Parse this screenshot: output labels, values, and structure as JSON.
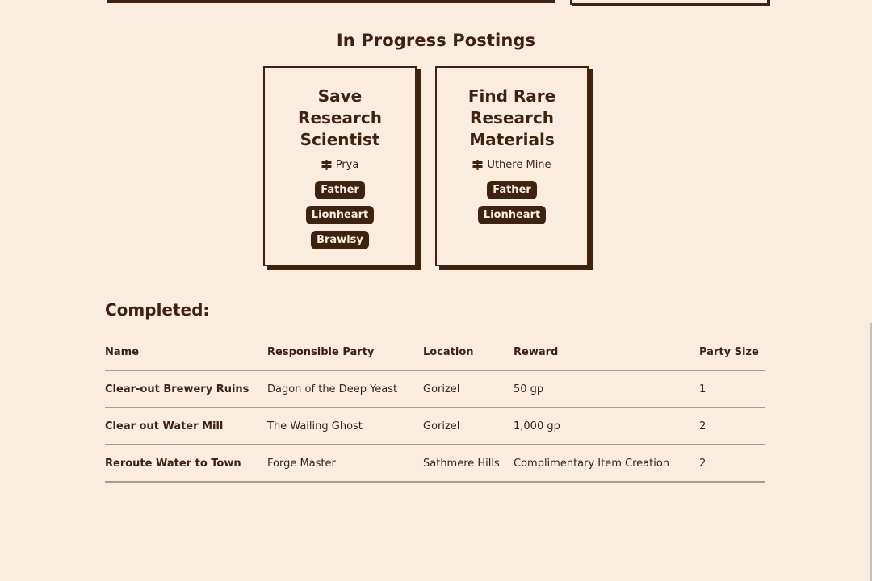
{
  "in_progress": {
    "title": "In Progress Postings",
    "cards": [
      {
        "title": "Save Research Scientist",
        "location": "Prya",
        "location_icon": "signpost-icon",
        "tags": [
          "Father",
          "Lionheart",
          "Brawlsy"
        ]
      },
      {
        "title": "Find Rare Research Materials",
        "location": "Uthere Mine",
        "location_icon": "signpost-icon",
        "tags": [
          "Father",
          "Lionheart"
        ]
      }
    ]
  },
  "completed": {
    "title": "Completed:",
    "columns": [
      "Name",
      "Responsible Party",
      "Location",
      "Reward",
      "Party Size"
    ],
    "rows": [
      [
        "Clear-out Brewery Ruins",
        "Dagon of the Deep Yeast",
        "Gorizel",
        "50 gp",
        "1"
      ],
      [
        "Clear out Water Mill",
        "The Wailing Ghost",
        "Gorizel",
        "1,000 gp",
        "2"
      ],
      [
        "Reroute Water to Town",
        "Forge Master",
        "Sathmere Hills",
        "Complimentary Item Creation",
        "2"
      ]
    ]
  },
  "colors": {
    "background": "#fbece0",
    "ink": "#3d2310",
    "rule": "#a99a8c"
  }
}
